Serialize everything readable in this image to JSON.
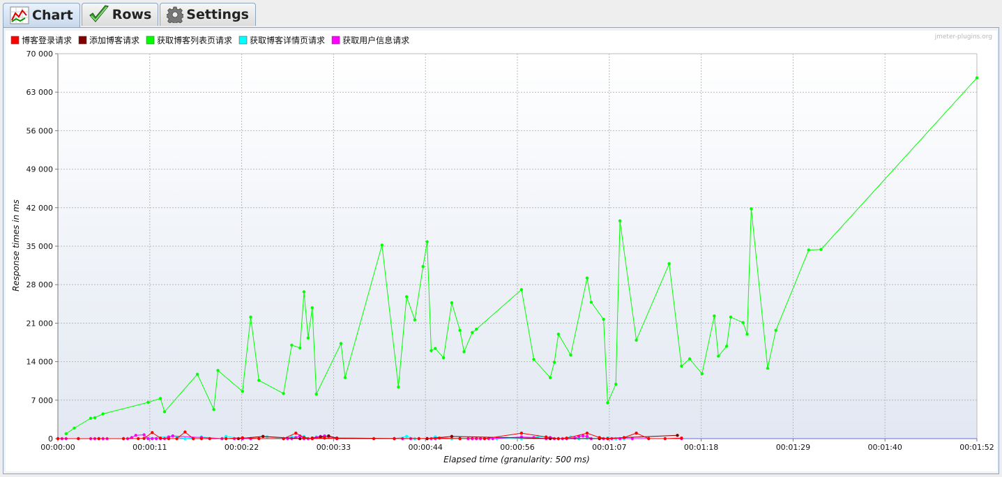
{
  "tabs": [
    {
      "label": "Chart",
      "icon": "chart-icon",
      "active": true
    },
    {
      "label": "Rows",
      "icon": "checkmark-icon",
      "active": false
    },
    {
      "label": "Settings",
      "icon": "gear-icon",
      "active": false
    }
  ],
  "watermark": "jmeter-plugins.org",
  "chart_data": {
    "type": "line",
    "ylabel": "Response times in ms",
    "xlabel": "Elapsed time (granularity: 500 ms)",
    "ylim": [
      0,
      70000
    ],
    "xlim": [
      0,
      112
    ],
    "yticks": [
      0,
      7000,
      14000,
      21000,
      28000,
      35000,
      42000,
      49000,
      56000,
      63000,
      70000
    ],
    "ytick_labels": [
      "0",
      "7 000",
      "14 000",
      "21 000",
      "28 000",
      "35 000",
      "42 000",
      "49 000",
      "56 000",
      "63 000",
      "70 000"
    ],
    "xticks": [
      0,
      11.2,
      22.4,
      33.6,
      44.8,
      56,
      67.2,
      78.4,
      89.6,
      100.8,
      112
    ],
    "xtick_labels": [
      "00:00:00",
      "00:00:11",
      "00:00:22",
      "00:00:33",
      "00:00:44",
      "00:00:56",
      "00:01:07",
      "00:01:18",
      "00:01:29",
      "00:01:40",
      "00:01:52"
    ],
    "grid": true,
    "legend_position": "top-left",
    "series": [
      {
        "name": "博客登录请求",
        "color": "#ff0000",
        "x": [
          0,
          2.5,
          5,
          8,
          9.8,
          10.5,
          11.5,
          12.5,
          13.5,
          14.5,
          15.5,
          16.5,
          17.5,
          18.5,
          20.5,
          22.5,
          24.5,
          27.5,
          29,
          30,
          31,
          32.5,
          34,
          38.5,
          41,
          44,
          46.5,
          49,
          52,
          56.5,
          59.5,
          61,
          62,
          64.5,
          66,
          67,
          69,
          70.5,
          72,
          74,
          76
        ],
        "y": [
          0,
          0,
          0,
          0,
          0,
          50,
          1100,
          100,
          0,
          0,
          1200,
          0,
          0,
          0,
          0,
          150,
          0,
          0,
          1000,
          200,
          0,
          100,
          0,
          0,
          0,
          0,
          100,
          0,
          0,
          1000,
          300,
          0,
          100,
          1000,
          200,
          0,
          200,
          1000,
          0,
          0,
          100
        ]
      },
      {
        "name": "添加博客请求",
        "color": "#800000",
        "x": [
          22,
          25,
          29.5,
          31,
          32,
          33,
          34,
          45,
          48,
          60,
          66,
          75.5
        ],
        "y": [
          0,
          400,
          0,
          100,
          300,
          500,
          100,
          0,
          400,
          0,
          0,
          600
        ]
      },
      {
        "name": "获取博客列表页请求",
        "color": "#00ff00",
        "x": [
          1,
          2,
          4,
          4.5,
          5.5,
          11,
          12.5,
          13,
          17,
          19,
          19.5,
          22.5,
          23.5,
          24.5,
          27.5,
          28.5,
          29.5,
          30,
          30.5,
          31,
          31.5,
          34.5,
          35,
          39.5,
          41.5,
          42.5,
          43.5,
          44.5,
          45,
          45.5,
          46,
          47,
          48,
          49,
          49.5,
          50.5,
          51,
          56.5,
          58,
          60,
          60.5,
          61,
          62.5,
          64.5,
          65,
          66.5,
          67,
          68,
          68.5,
          70.5,
          74.5,
          76,
          77,
          78.5,
          80,
          80.5,
          81.5,
          82,
          83.5,
          84,
          84.5,
          86.5,
          87.5,
          91.5,
          93,
          112
        ],
        "y": [
          900,
          1900,
          3700,
          3800,
          4500,
          6600,
          7300,
          4900,
          11700,
          5300,
          12400,
          8600,
          22100,
          10600,
          8200,
          17000,
          16500,
          26700,
          18300,
          23800,
          8100,
          17300,
          11100,
          35200,
          9400,
          25800,
          21600,
          31300,
          35800,
          16000,
          16400,
          14700,
          24700,
          19700,
          15800,
          19300,
          19900,
          27100,
          14400,
          11100,
          13900,
          19000,
          15200,
          29200,
          24800,
          21700,
          6500,
          9900,
          39600,
          17900,
          31800,
          13200,
          14500,
          11800,
          22300,
          15000,
          16800,
          22100,
          21100,
          19000,
          41800,
          12800,
          19700,
          34300,
          34400,
          65600
        ]
      },
      {
        "name": "获取博客详情页请求",
        "color": "#00ffff",
        "x": [
          0,
          10.5,
          14,
          15.5,
          17.5,
          20,
          20.5,
          22.5,
          25.5,
          27.5,
          28.5,
          30,
          30.5,
          31.5,
          32.5,
          41,
          42.5,
          43.5,
          45,
          46,
          48,
          49,
          51,
          53.5,
          56.5,
          58.5,
          60,
          61,
          62.5,
          63.5,
          64.5,
          66,
          67,
          68,
          69
        ],
        "y": [
          0,
          0,
          500,
          0,
          300,
          0,
          400,
          0,
          300,
          0,
          300,
          400,
          0,
          300,
          200,
          0,
          400,
          0,
          0,
          300,
          0,
          100,
          0,
          0,
          0,
          400,
          200,
          0,
          300,
          0,
          100,
          0,
          100,
          0,
          0
        ]
      },
      {
        "name": "获取用户信息请求",
        "color": "#ff00ff",
        "x": [
          0,
          0.5,
          1,
          2.5,
          4,
          4.5,
          5,
          5.5,
          6,
          8,
          8.5,
          9,
          9.5,
          10.5,
          11,
          11.5,
          12,
          12.5,
          13,
          13.5,
          14,
          17.5,
          20,
          21.5,
          22.5,
          23.5,
          27.5,
          28,
          28.5,
          29,
          29.5,
          30,
          30.5,
          31,
          31.5,
          32,
          32.5,
          33,
          34,
          41,
          42,
          43,
          44,
          45,
          45.5,
          46,
          49,
          50,
          50.5,
          51,
          51.5,
          52,
          52.5,
          53,
          56.5,
          58,
          59.5,
          60,
          60.5,
          61,
          61.5,
          62,
          63,
          63.5,
          64,
          64.5,
          65,
          66,
          66.5,
          67,
          67.5,
          68.5,
          70,
          76
        ],
        "y": [
          0,
          0,
          0,
          0,
          0,
          0,
          0,
          0,
          0,
          0,
          0,
          200,
          600,
          700,
          0,
          0,
          0,
          0,
          0,
          300,
          500,
          200,
          0,
          0,
          0,
          0,
          0,
          0,
          0,
          200,
          500,
          0,
          0,
          0,
          200,
          400,
          500,
          400,
          0,
          0,
          0,
          0,
          0,
          0,
          0,
          0,
          0,
          0,
          0,
          0,
          0,
          0,
          0,
          0,
          300,
          200,
          0,
          200,
          0,
          0,
          0,
          0,
          100,
          400,
          500,
          400,
          0,
          0,
          0,
          0,
          0,
          0,
          0,
          0
        ]
      }
    ]
  }
}
